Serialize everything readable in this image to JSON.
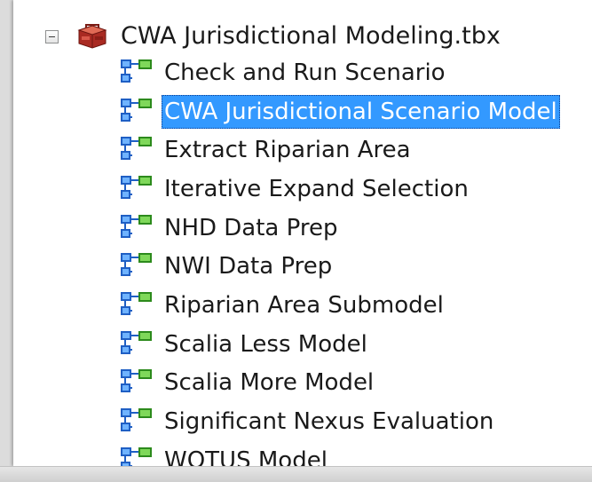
{
  "toolbox": {
    "name": "CWA Jurisdictional Modeling.tbx",
    "expanded": true,
    "icon": "toolbox-icon"
  },
  "tools": [
    {
      "label": "Check and Run Scenario",
      "icon": "model-icon",
      "selected": false
    },
    {
      "label": "CWA Jurisdictional Scenario Model",
      "icon": "model-icon",
      "selected": true
    },
    {
      "label": "Extract Riparian Area",
      "icon": "model-icon",
      "selected": false
    },
    {
      "label": "Iterative Expand Selection",
      "icon": "model-icon",
      "selected": false
    },
    {
      "label": "NHD Data Prep",
      "icon": "model-icon",
      "selected": false
    },
    {
      "label": "NWI Data Prep",
      "icon": "model-icon",
      "selected": false
    },
    {
      "label": "Riparian Area Submodel",
      "icon": "model-icon",
      "selected": false
    },
    {
      "label": "Scalia Less Model",
      "icon": "model-icon",
      "selected": false
    },
    {
      "label": "Scalia More Model",
      "icon": "model-icon",
      "selected": false
    },
    {
      "label": "Significant Nexus Evaluation",
      "icon": "model-icon",
      "selected": false
    },
    {
      "label": "WOTUS Model",
      "icon": "model-icon",
      "selected": false
    }
  ],
  "colors": {
    "selection": "#3399ff",
    "model_icon_blue": "#2f6fd6",
    "model_icon_green": "#3fae2a",
    "toolbox_red": "#c0392b"
  }
}
